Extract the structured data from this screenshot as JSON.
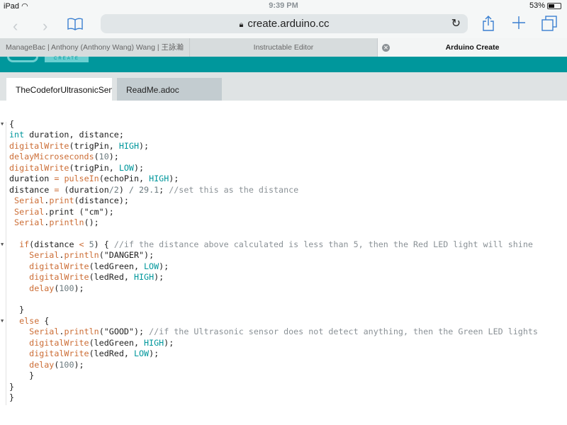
{
  "status_bar": {
    "device": "iPad",
    "time": "9:39 PM",
    "battery": "53%",
    "battery_level": 0.53
  },
  "browser": {
    "url": "create.arduino.cc",
    "tabs": [
      {
        "label": "ManageBac | Anthony (Anthony Wang) Wang | 王詠瀚",
        "active": false
      },
      {
        "label": "Instructable Editor",
        "active": false
      },
      {
        "label": "Arduino Create",
        "active": true
      }
    ]
  },
  "app": {
    "logo_text": "CREATE",
    "accent": "#00979c"
  },
  "file_tabs": [
    {
      "label": "TheCodeforUltrasonicSensor",
      "active": true
    },
    {
      "label": "ReadMe.adoc",
      "active": false
    }
  ],
  "code": {
    "folds": [
      0,
      11,
      18
    ],
    "lines": [
      [
        [
          "{",
          "p"
        ]
      ],
      [
        [
          "int",
          "k"
        ],
        [
          " duration, distance;",
          "p"
        ]
      ],
      [
        [
          "digitalWrite",
          "f"
        ],
        [
          "(trigPin, ",
          "p"
        ],
        [
          "HIGH",
          "k"
        ],
        [
          ");",
          "p"
        ]
      ],
      [
        [
          "delayMicroseconds",
          "f"
        ],
        [
          "(",
          "p"
        ],
        [
          "10",
          "n"
        ],
        [
          ");",
          "p"
        ]
      ],
      [
        [
          "digitalWrite",
          "f"
        ],
        [
          "(trigPin, ",
          "p"
        ],
        [
          "LOW",
          "k"
        ],
        [
          ");",
          "p"
        ]
      ],
      [
        [
          "duration ",
          "p"
        ],
        [
          "=",
          "o"
        ],
        [
          " ",
          "p"
        ],
        [
          "pulseIn",
          "f"
        ],
        [
          "(echoPin, ",
          "p"
        ],
        [
          "HIGH",
          "k"
        ],
        [
          ");",
          "p"
        ]
      ],
      [
        [
          "distance ",
          "p"
        ],
        [
          "=",
          "o"
        ],
        [
          " (duration",
          "p"
        ],
        [
          "/2",
          "n"
        ],
        [
          ") ",
          "p"
        ],
        [
          "/ 29.1",
          "n"
        ],
        [
          "; ",
          "p"
        ],
        [
          "//set this as the distance",
          "c"
        ]
      ],
      [
        [
          " ",
          "p"
        ],
        [
          "Serial",
          "f"
        ],
        [
          ".",
          "p"
        ],
        [
          "print",
          "f"
        ],
        [
          "(distance);",
          "p"
        ]
      ],
      [
        [
          " ",
          "p"
        ],
        [
          "Serial",
          "f"
        ],
        [
          ".print (\"cm\");",
          "p"
        ]
      ],
      [
        [
          " ",
          "p"
        ],
        [
          "Serial",
          "f"
        ],
        [
          ".",
          "p"
        ],
        [
          "println",
          "f"
        ],
        [
          "();",
          "p"
        ]
      ],
      [
        [
          "",
          "p"
        ]
      ],
      [
        [
          "  ",
          "p"
        ],
        [
          "if",
          "f"
        ],
        [
          "(distance ",
          "p"
        ],
        [
          "<",
          "o"
        ],
        [
          " ",
          "p"
        ],
        [
          "5",
          "n"
        ],
        [
          ") { ",
          "p"
        ],
        [
          "//if the distance above calculated is less than 5, then the Red LED light will shine",
          "c"
        ]
      ],
      [
        [
          "    ",
          "p"
        ],
        [
          "Serial",
          "f"
        ],
        [
          ".",
          "p"
        ],
        [
          "println",
          "f"
        ],
        [
          "(\"DANGER\");",
          "p"
        ]
      ],
      [
        [
          "    ",
          "p"
        ],
        [
          "digitalWrite",
          "f"
        ],
        [
          "(ledGreen, ",
          "p"
        ],
        [
          "LOW",
          "k"
        ],
        [
          ");",
          "p"
        ]
      ],
      [
        [
          "    ",
          "p"
        ],
        [
          "digitalWrite",
          "f"
        ],
        [
          "(ledRed, ",
          "p"
        ],
        [
          "HIGH",
          "k"
        ],
        [
          ");",
          "p"
        ]
      ],
      [
        [
          "    ",
          "p"
        ],
        [
          "delay",
          "f"
        ],
        [
          "(",
          "p"
        ],
        [
          "100",
          "n"
        ],
        [
          ");",
          "p"
        ]
      ],
      [
        [
          "",
          "p"
        ]
      ],
      [
        [
          "  }",
          "p"
        ]
      ],
      [
        [
          "  ",
          "p"
        ],
        [
          "else",
          "f"
        ],
        [
          " {",
          "p"
        ]
      ],
      [
        [
          "    ",
          "p"
        ],
        [
          "Serial",
          "f"
        ],
        [
          ".",
          "p"
        ],
        [
          "println",
          "f"
        ],
        [
          "(\"GOOD\"); ",
          "p"
        ],
        [
          "//if the Ultrasonic sensor does not detect anything, then the Green LED lights",
          "c"
        ]
      ],
      [
        [
          "    ",
          "p"
        ],
        [
          "digitalWrite",
          "f"
        ],
        [
          "(ledGreen, ",
          "p"
        ],
        [
          "HIGH",
          "k"
        ],
        [
          ");",
          "p"
        ]
      ],
      [
        [
          "    ",
          "p"
        ],
        [
          "digitalWrite",
          "f"
        ],
        [
          "(ledRed, ",
          "p"
        ],
        [
          "LOW",
          "k"
        ],
        [
          ");",
          "p"
        ]
      ],
      [
        [
          "    ",
          "p"
        ],
        [
          "delay",
          "f"
        ],
        [
          "(",
          "p"
        ],
        [
          "100",
          "n"
        ],
        [
          ");",
          "p"
        ]
      ],
      [
        [
          "    }",
          "p"
        ]
      ],
      [
        [
          "}",
          "p"
        ]
      ],
      [
        [
          "}",
          "p"
        ]
      ]
    ]
  }
}
